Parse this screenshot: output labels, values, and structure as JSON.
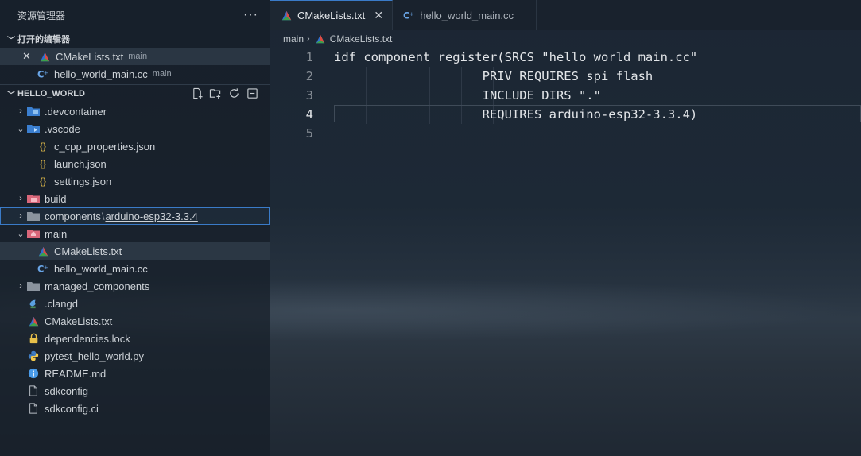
{
  "sidebar": {
    "title": "资源管理器",
    "more": "···",
    "open_editors": {
      "label": "打开的编辑器",
      "items": [
        {
          "name": "CMakeLists.txt",
          "desc": "main",
          "close": "✕"
        },
        {
          "name": "hello_world_main.cc",
          "desc": "main"
        }
      ]
    },
    "workspace": {
      "label": "HELLO_WORLD",
      "items": {
        "devcontainer": ".devcontainer",
        "vscode": ".vscode",
        "c_cpp": "c_cpp_properties.json",
        "launch": "launch.json",
        "settings": "settings.json",
        "build": "build",
        "components": "components",
        "components_sep": "\\",
        "components_sub": "arduino-esp32-3.3.4",
        "main": "main",
        "main_cmake": "CMakeLists.txt",
        "main_cc": "hello_world_main.cc",
        "managed": "managed_components",
        "clangd": ".clangd",
        "cmake": "CMakeLists.txt",
        "deps": "dependencies.lock",
        "pytest": "pytest_hello_world.py",
        "readme": "README.md",
        "sdkconfig": "sdkconfig",
        "sdkconfig_ci": "sdkconfig.ci"
      }
    }
  },
  "tabs": [
    {
      "label": "CMakeLists.txt",
      "close": "✕"
    },
    {
      "label": "hello_world_main.cc"
    }
  ],
  "breadcrumb": {
    "folder": "main",
    "file": "CMakeLists.txt"
  },
  "editor": {
    "lines": [
      {
        "num": "1",
        "text": "idf_component_register(SRCS \"hello_world_main.cc\""
      },
      {
        "num": "2",
        "text": "                    PRIV_REQUIRES spi_flash"
      },
      {
        "num": "3",
        "text": "                    INCLUDE_DIRS \".\""
      },
      {
        "num": "4",
        "text": "                    REQUIRES arduino-esp32-3.3.4)"
      },
      {
        "num": "5",
        "text": ""
      }
    ]
  },
  "colors": {
    "accent": "#3a7bc8",
    "cmake_red": "#e04a3f",
    "cpp_blue": "#6aa6e8",
    "json_yellow": "#e8c04a"
  }
}
